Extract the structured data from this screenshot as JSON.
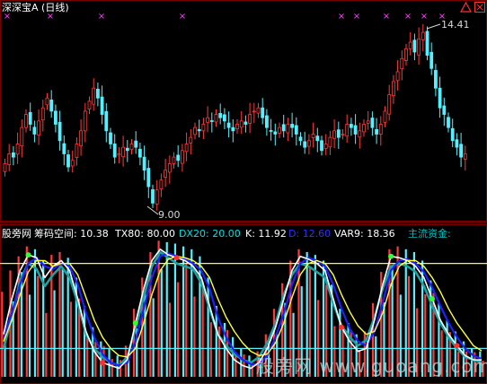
{
  "title": "深深宝A (日线)",
  "max_label": "14.41",
  "min_label": "9.00",
  "nav": {
    "up_icon": "triangle-up-icon",
    "close_icon": "close-icon"
  },
  "panel": {
    "name": "股旁网",
    "items": [
      {
        "label": "筹码空间: 10.38",
        "color": "#ffffff"
      },
      {
        "label": "TX80: 80.00",
        "color": "#ffffff"
      },
      {
        "label": "DX20: 20.00",
        "color": "#00e0e0"
      },
      {
        "label": "K: 11.92",
        "color": "#ffffff"
      },
      {
        "label": "D: 12.60",
        "color": "#3030ff"
      },
      {
        "label": "VAR9: 18.36",
        "color": "#ffffff"
      },
      {
        "label": "主流资金:",
        "color": "#00c0c0"
      }
    ]
  },
  "watermark": "股旁网 www.guoang.com",
  "colors": {
    "up": "#ff3a3a",
    "down": "#55f0ff",
    "k": "#ffffff",
    "d": "#2020ff",
    "var9": "#ffff40",
    "main": "#20a0a0",
    "line80": "#ffff40",
    "line20": "#55f0ff",
    "marker": "#ff40ff"
  },
  "chart_data": [
    {
      "type": "candlestick",
      "title": "深深宝A (日线)",
      "annotations": [
        {
          "label": "14.41",
          "type": "max"
        },
        {
          "label": "9.00",
          "type": "min"
        }
      ],
      "closes": [
        10.3,
        10.6,
        10.5,
        10.9,
        11.4,
        11.8,
        11.5,
        11.2,
        11.6,
        12.0,
        12.3,
        11.9,
        11.5,
        11.0,
        10.6,
        10.2,
        10.4,
        10.9,
        11.3,
        11.9,
        12.2,
        12.6,
        12.3,
        11.8,
        11.3,
        10.9,
        10.5,
        10.6,
        10.8,
        10.7,
        10.9,
        10.8,
        10.5,
        10.1,
        9.6,
        9.1,
        9.5,
        9.8,
        10.1,
        10.3,
        10.5,
        10.4,
        10.7,
        10.9,
        11.1,
        11.4,
        11.3,
        11.5,
        11.7,
        11.6,
        11.8,
        11.7,
        11.6,
        11.4,
        11.3,
        11.5,
        11.6,
        11.5,
        11.8,
        11.9,
        12.0,
        11.7,
        11.4,
        11.3,
        11.2,
        11.4,
        11.3,
        11.5,
        11.4,
        11.2,
        11.0,
        10.8,
        11.0,
        11.2,
        11.0,
        10.7,
        10.9,
        11.1,
        11.3,
        11.1,
        11.2,
        11.5,
        11.4,
        11.2,
        11.3,
        11.5,
        11.6,
        11.4,
        11.2,
        11.5,
        11.9,
        12.4,
        12.8,
        13.1,
        13.5,
        13.8,
        14.0,
        13.7,
        14.1,
        14.3,
        13.6,
        13.2,
        12.6,
        12.0,
        11.8,
        11.4,
        11.0,
        10.8,
        10.5,
        10.6
      ],
      "ylim": [
        9.0,
        14.41
      ]
    },
    {
      "type": "line",
      "title": "股旁网",
      "ylim": [
        0,
        100
      ],
      "reference_lines": [
        80,
        20
      ],
      "series": [
        {
          "name": "K",
          "values": [
            30,
            55,
            75,
            86,
            84,
            70,
            78,
            82,
            75,
            55,
            32,
            18,
            10,
            8,
            6,
            12,
            38,
            62,
            82,
            90,
            86,
            84,
            82,
            78,
            70,
            50,
            30,
            20,
            12,
            8,
            6,
            10,
            20,
            35,
            55,
            75,
            85,
            83,
            80,
            75,
            55,
            35,
            25,
            18,
            20,
            40,
            65,
            85,
            84,
            82,
            78,
            70,
            55,
            40,
            30,
            22,
            15,
            12,
            11.92
          ]
        },
        {
          "name": "D",
          "values": [
            28,
            45,
            65,
            80,
            84,
            78,
            76,
            80,
            78,
            65,
            45,
            28,
            16,
            10,
            8,
            10,
            25,
            48,
            70,
            85,
            87,
            85,
            83,
            80,
            75,
            62,
            42,
            28,
            18,
            12,
            9,
            9,
            15,
            28,
            45,
            65,
            80,
            84,
            82,
            78,
            65,
            48,
            34,
            25,
            22,
            32,
            52,
            75,
            82,
            83,
            80,
            74,
            63,
            50,
            38,
            28,
            20,
            15,
            12.6
          ]
        },
        {
          "name": "VAR9",
          "values": [
            25,
            40,
            58,
            74,
            82,
            82,
            78,
            80,
            80,
            72,
            56,
            40,
            28,
            20,
            15,
            14,
            20,
            38,
            58,
            75,
            83,
            85,
            84,
            82,
            78,
            70,
            55,
            42,
            32,
            24,
            18,
            15,
            16,
            24,
            38,
            56,
            72,
            80,
            82,
            80,
            72,
            58,
            46,
            36,
            30,
            32,
            45,
            65,
            78,
            82,
            82,
            78,
            70,
            60,
            48,
            38,
            30,
            22,
            18.36
          ]
        },
        {
          "name": "主流资金",
          "values": [
            20,
            42,
            68,
            80,
            76,
            64,
            72,
            78,
            70,
            52,
            30,
            20,
            14,
            10,
            8,
            14,
            34,
            56,
            78,
            88,
            84,
            80,
            78,
            76,
            66,
            48,
            30,
            22,
            16,
            12,
            10,
            14,
            24,
            38,
            58,
            72,
            80,
            78,
            74,
            70,
            52,
            36,
            28,
            22,
            26,
            42,
            62,
            78,
            80,
            78,
            74,
            64,
            50,
            38,
            28,
            20,
            14,
            12,
            10
          ]
        }
      ],
      "bars": [
        60,
        75,
        85,
        92,
        90,
        82,
        86,
        88,
        84,
        70,
        50,
        35,
        25,
        20,
        15,
        22,
        48,
        70,
        88,
        96,
        95,
        94,
        92,
        90,
        85,
        70,
        50,
        38,
        28,
        20,
        15,
        18,
        30,
        48,
        66,
        82,
        90,
        88,
        86,
        82,
        65,
        48,
        38,
        30,
        32,
        52,
        74,
        90,
        92,
        90,
        88,
        82,
        68,
        52,
        40,
        32,
        25,
        20,
        18
      ]
    }
  ]
}
